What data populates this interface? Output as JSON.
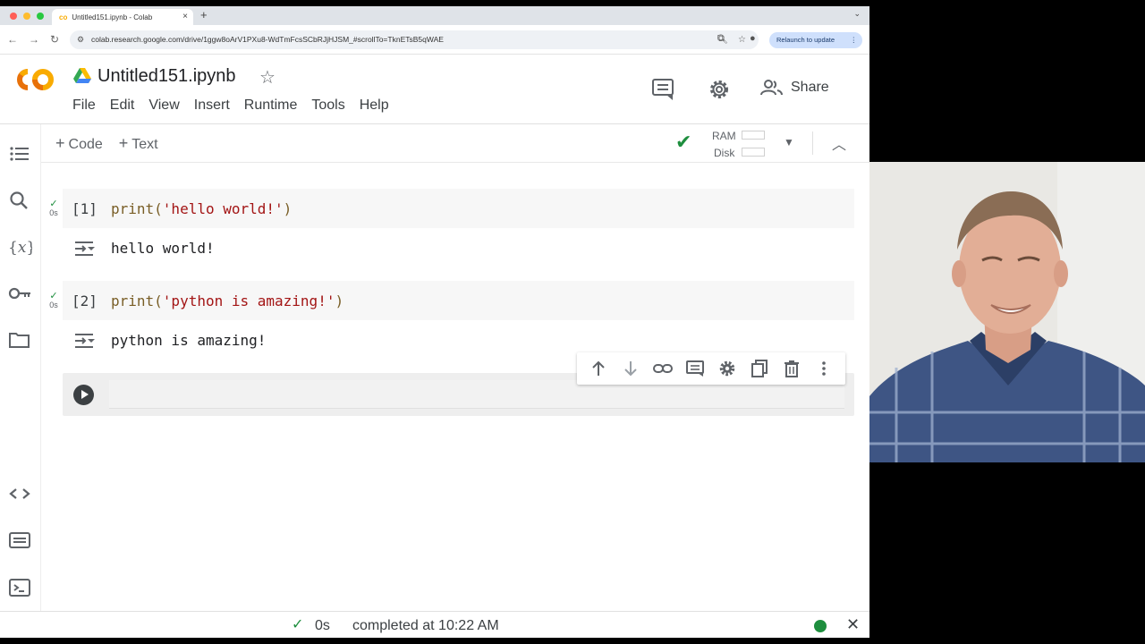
{
  "browser": {
    "tab_title": "Untitled151.ipynb - Colab",
    "new_tab": "+",
    "url": "colab.research.google.com/drive/1ggw8oArV1PXu8-WdTmFcsSCbRJjHJSM_#scrollTo=TknETsB5qWAE",
    "relaunch_label": "Relaunch to update"
  },
  "header": {
    "logo_text": "CO",
    "notebook_title": "Untitled151.ipynb",
    "menu": [
      "File",
      "Edit",
      "View",
      "Insert",
      "Runtime",
      "Tools",
      "Help"
    ],
    "share_label": "Share"
  },
  "toolbar": {
    "code_label": "Code",
    "text_label": "Text",
    "ram_label": "RAM",
    "disk_label": "Disk"
  },
  "cells": [
    {
      "exec_count": "[1]",
      "code_fn": "print(",
      "code_str": "'hello world!'",
      "code_end": ")",
      "run_time": "0s",
      "output": "hello world!"
    },
    {
      "exec_count": "[2]",
      "code_fn": "print(",
      "code_str": "'python is amazing!'",
      "code_end": ")",
      "run_time": "0s",
      "output": "python is amazing!"
    }
  ],
  "statusbar": {
    "time": "0s",
    "text": "completed at 10:22 AM"
  },
  "colors": {
    "accent_orange": "#f9ab00",
    "success_green": "#1e8e3e",
    "string_red": "#a31515"
  },
  "icons": [
    "table-of-contents-icon",
    "search-icon",
    "variables-icon",
    "key-icon",
    "folder-icon",
    "code-snippets-icon",
    "command-palette-icon",
    "terminal-icon",
    "comment-icon",
    "gear-icon",
    "share-people-icon"
  ]
}
